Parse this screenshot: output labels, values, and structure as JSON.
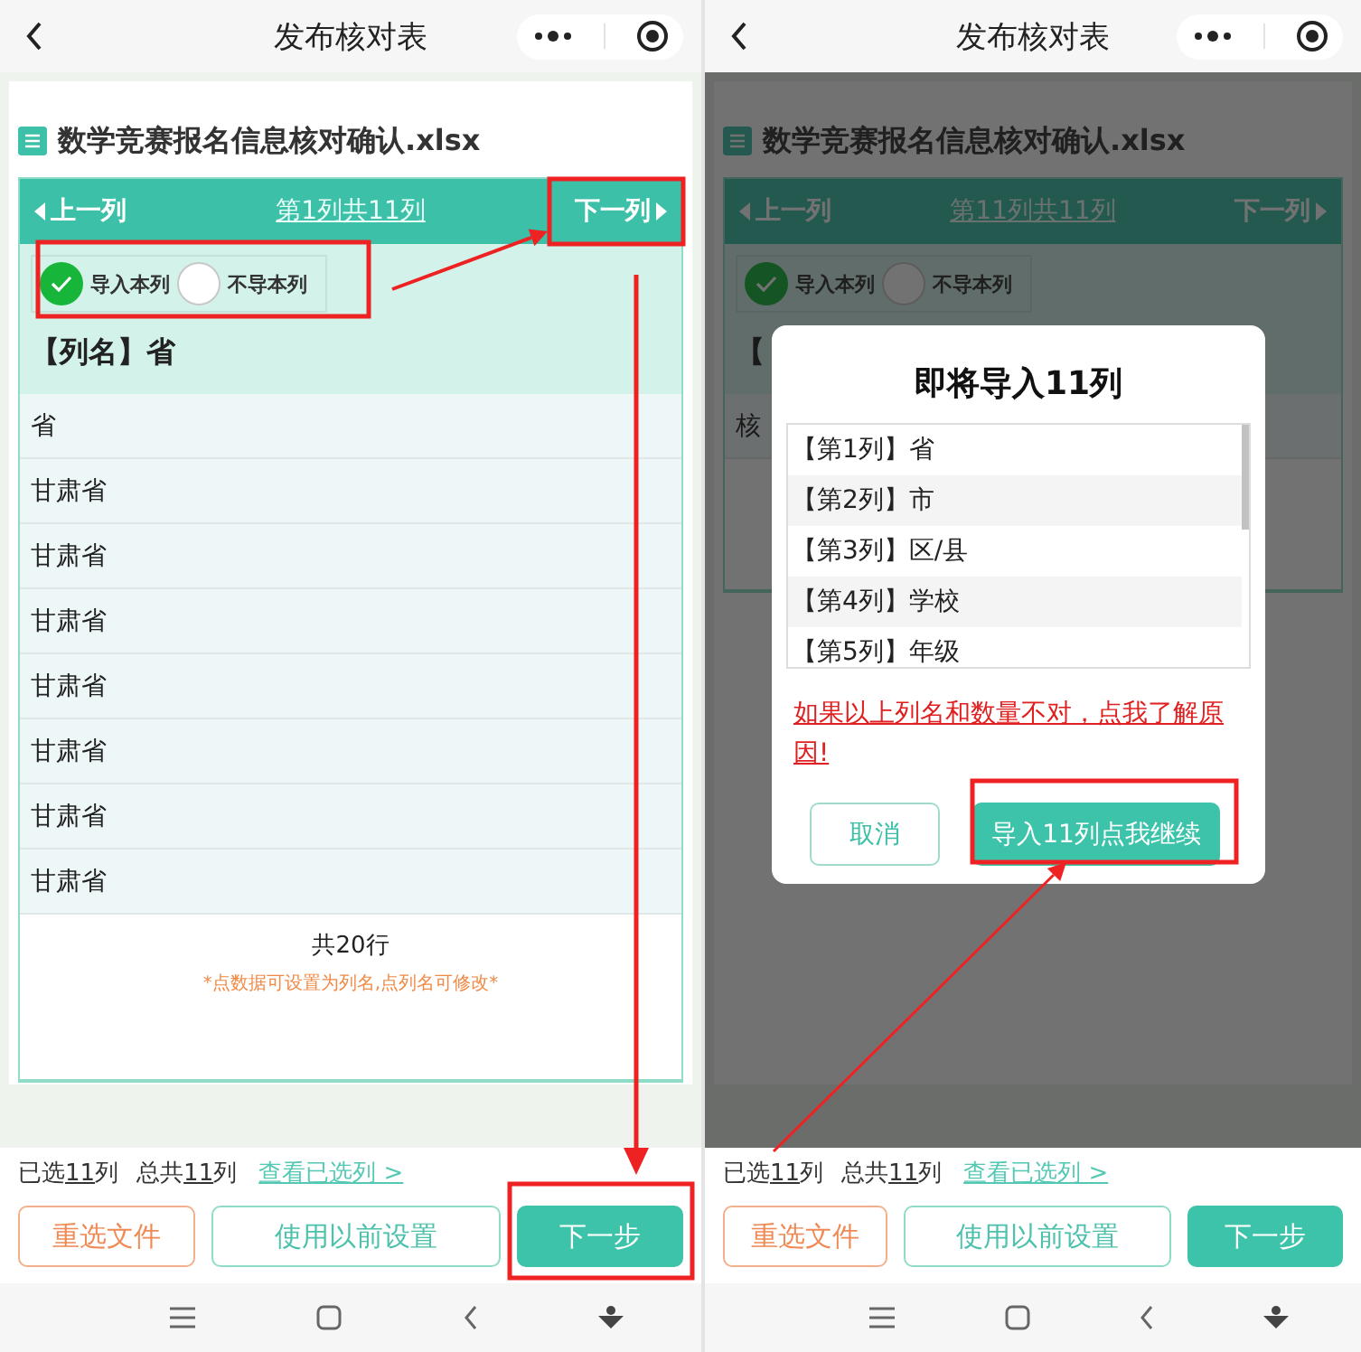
{
  "screens": [
    {
      "nav": {
        "title": "发布核对表"
      },
      "file": {
        "name": "数学竞赛报名信息核对确认.xlsx"
      },
      "column_nav": {
        "prev": "上一列",
        "position": "第1列共11列",
        "next": "下一列"
      },
      "import_options": [
        {
          "label": "导入本列",
          "selected": true
        },
        {
          "label": "不导本列",
          "selected": false
        }
      ],
      "column_name": "【列名】省",
      "rows": [
        "省",
        "甘肃省",
        "甘肃省",
        "甘肃省",
        "甘肃省",
        "甘肃省",
        "甘肃省",
        "甘肃省"
      ],
      "footer": {
        "total": "共20行",
        "hint": "*点数据可设置为列名,点列名可修改*"
      },
      "summary": {
        "selected_prefix": "已选",
        "selected_count": "11",
        "selected_suffix": "列",
        "total_prefix": "总共",
        "total_count": "11",
        "total_suffix": "列",
        "link": "查看已选列 >"
      },
      "buttons": [
        {
          "label": "重选文件",
          "kind": "warning"
        },
        {
          "label": "使用以前设置",
          "kind": "outline"
        },
        {
          "label": "下一步",
          "kind": "primary"
        }
      ]
    },
    {
      "nav": {
        "title": "发布核对表"
      },
      "file": {
        "name": "数学竞赛报名信息核对确认.xlsx"
      },
      "column_nav": {
        "prev": "上一列",
        "position": "第11列共11列",
        "next": "下一列"
      },
      "import_options": [
        {
          "label": "导入本列",
          "selected": true
        },
        {
          "label": "不导本列",
          "selected": false
        }
      ],
      "column_name": "【",
      "rows": [
        "核"
      ],
      "summary": {
        "selected_prefix": "已选",
        "selected_count": "11",
        "selected_suffix": "列",
        "total_prefix": "总共",
        "total_count": "11",
        "total_suffix": "列",
        "link": "查看已选列 >"
      },
      "buttons": [
        {
          "label": "重选文件",
          "kind": "warning"
        },
        {
          "label": "使用以前设置",
          "kind": "outline"
        },
        {
          "label": "下一步",
          "kind": "primary"
        }
      ],
      "dialog": {
        "title": "即将导入11列",
        "items": [
          "【第1列】省",
          "【第2列】市",
          "【第3列】区/县",
          "【第4列】学校",
          "【第5列】年级"
        ],
        "link": "如果以上列名和数量不对，点我了解原因!",
        "buttons": [
          {
            "label": "取消",
            "kind": "outline"
          },
          {
            "label": "导入11列点我继续",
            "kind": "primary"
          }
        ]
      }
    }
  ]
}
